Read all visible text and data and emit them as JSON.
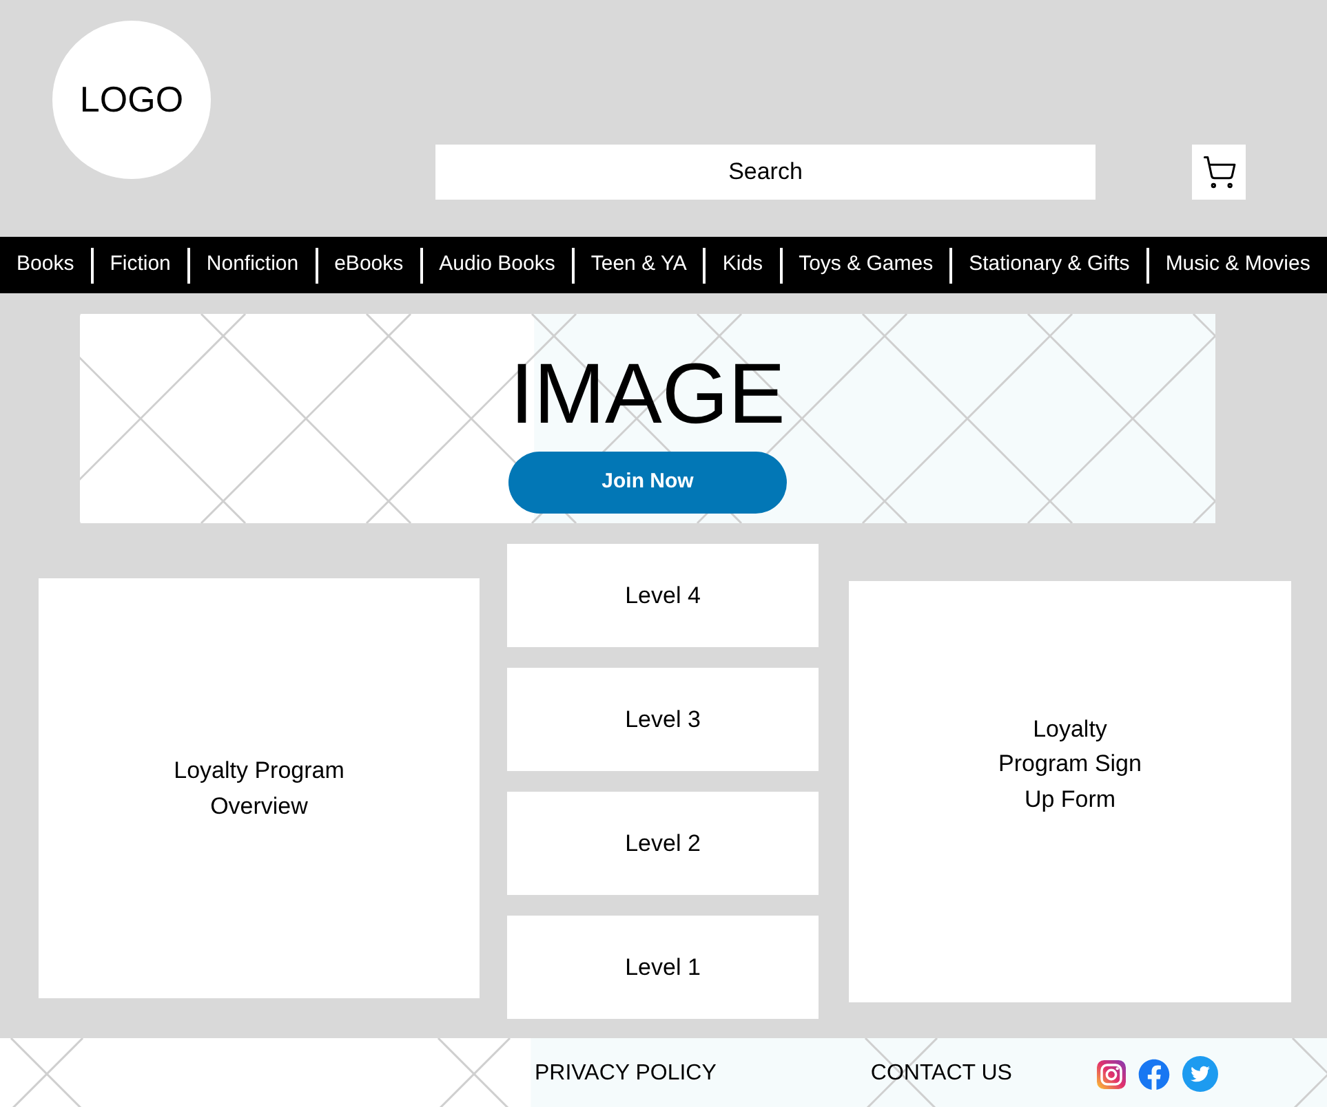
{
  "logo": "LOGO",
  "search": {
    "placeholder": "Search"
  },
  "nav": [
    "Books",
    "Fiction",
    "Nonfiction",
    "eBooks",
    "Audio Books",
    "Teen & YA",
    "Kids",
    "Toys & Games",
    "Stationary & Gifts",
    "Music & Movies"
  ],
  "banner": {
    "kind": "picture",
    "title": "IMAGE",
    "button": "Join Now"
  },
  "overview": "Loyalty Program Overview",
  "levels": [
    "Level 4",
    "Level 3",
    "Level 2",
    "Level 1"
  ],
  "signup": "Loyalty Program Sign Up Form",
  "footer": {
    "links": [
      "PRIVACY POLICY",
      "CONTACT US"
    ]
  }
}
